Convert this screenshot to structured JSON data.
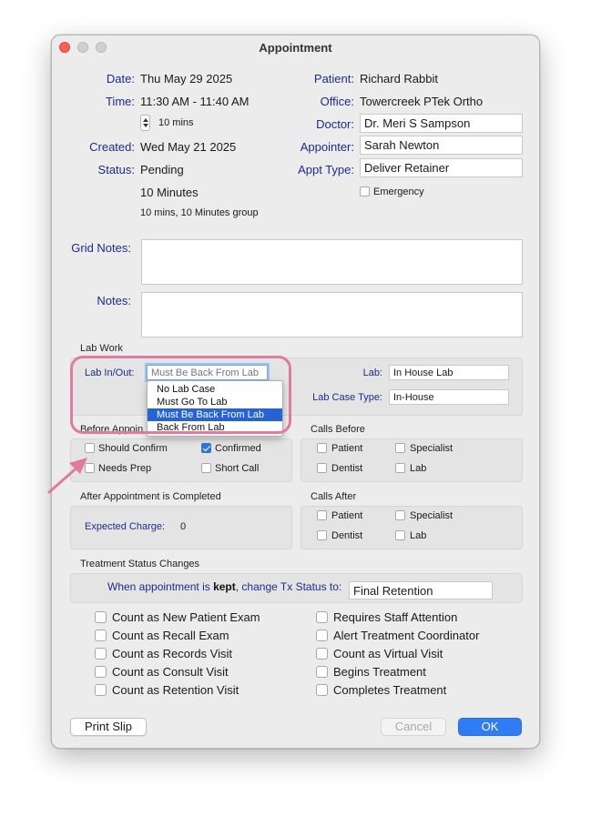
{
  "window": {
    "title": "Appointment"
  },
  "left_info": {
    "date_label": "Date:",
    "date_value": "Thu May 29 2025",
    "time_label": "Time:",
    "time_value": "11:30 AM - 11:40 AM",
    "duration_value": "10 mins",
    "created_label": "Created:",
    "created_value": "Wed May 21 2025",
    "status_label": "Status:",
    "status_value": "Pending",
    "type_value": "10 Minutes",
    "type_group": "10 mins, 10 Minutes group"
  },
  "right_info": {
    "patient_label": "Patient:",
    "patient_value": "Richard Rabbit",
    "office_label": "Office:",
    "office_value": "Towercreek PTek Ortho",
    "doctor_label": "Doctor:",
    "doctor_value": "Dr. Meri S Sampson",
    "appointer_label": "Appointer:",
    "appointer_value": "Sarah Newton",
    "appt_type_label": "Appt Type:",
    "appt_type_value": "Deliver Retainer",
    "emergency_label": "Emergency"
  },
  "notes": {
    "grid_notes_label": "Grid Notes:",
    "notes_label": "Notes:"
  },
  "lab_work": {
    "section_label": "Lab Work",
    "lab_in_out_label": "Lab In/Out:",
    "lab_in_out_value": "Must Be Back From Lab",
    "lab_label": "Lab:",
    "lab_value": "In House Lab",
    "lab_case_type_label": "Lab Case Type:",
    "lab_case_type_value": "In-House",
    "options": [
      "No Lab Case",
      "Must Go To Lab",
      "Must Be Back From Lab",
      "Back From Lab"
    ],
    "selected_option": "Must Be Back From Lab"
  },
  "before_appointment": {
    "section_label": "Before Appoin",
    "should_confirm": "Should Confirm",
    "confirmed": "Confirmed",
    "needs_prep": "Needs Prep",
    "short_call": "Short Call"
  },
  "calls_before": {
    "section_label": "Calls Before",
    "patient": "Patient",
    "specialist": "Specialist",
    "dentist": "Dentist",
    "lab": "Lab"
  },
  "after_appointment": {
    "section_label": "After Appointment is Completed",
    "expected_charge_label": "Expected Charge:",
    "expected_charge_value": "0"
  },
  "calls_after": {
    "section_label": "Calls After",
    "patient": "Patient",
    "specialist": "Specialist",
    "dentist": "Dentist",
    "lab": "Lab"
  },
  "treatment": {
    "section_label": "Treatment Status Changes",
    "kept_prefix": "When appointment is ",
    "kept_bold": "kept",
    "kept_suffix": ", change Tx Status to:",
    "tx_status_value": "Final Retention"
  },
  "counts_left": [
    "Count as New Patient Exam",
    "Count as Recall Exam",
    "Count as Records Visit",
    "Count as Consult Visit",
    "Count as Retention Visit"
  ],
  "counts_right": [
    "Requires Staff Attention",
    "Alert Treatment Coordinator",
    "Count as Virtual Visit",
    "Begins Treatment",
    "Completes Treatment"
  ],
  "buttons": {
    "print_slip": "Print Slip",
    "cancel": "Cancel",
    "ok": "OK"
  },
  "colors": {
    "label_blue": "#1d2b8c",
    "highlight_pink": "#e07aa0",
    "selection_blue": "#2563d6",
    "ok_blue": "#2f7cf6"
  }
}
